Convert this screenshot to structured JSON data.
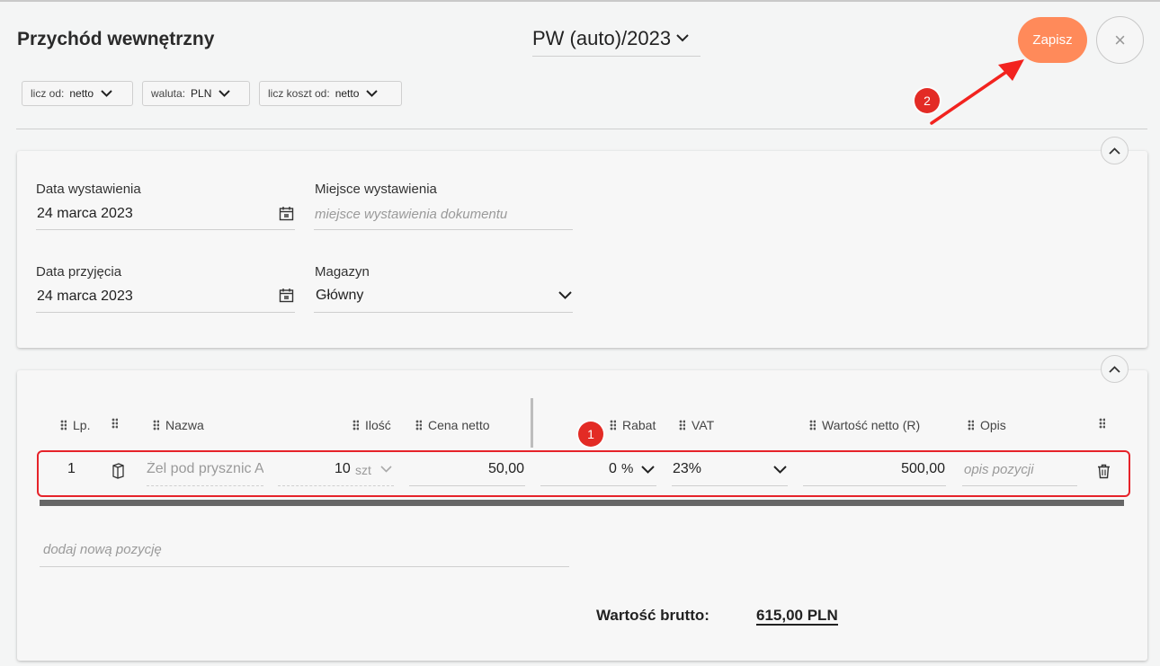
{
  "header": {
    "title": "Przychód wewnętrzny",
    "doc_number": "PW (auto)/2023",
    "save_label": "Zapisz",
    "close_label": "×"
  },
  "chips": [
    {
      "label": "licz od:",
      "value": "netto"
    },
    {
      "label": "waluta:",
      "value": "PLN"
    },
    {
      "label": "licz koszt od:",
      "value": "netto"
    }
  ],
  "form": {
    "issue_date_label": "Data wystawienia",
    "issue_date_value": "24 marca 2023",
    "issue_place_label": "Miejsce wystawienia",
    "issue_place_placeholder": "miejsce wystawienia dokumentu",
    "receipt_date_label": "Data przyjęcia",
    "receipt_date_value": "24 marca 2023",
    "warehouse_label": "Magazyn",
    "warehouse_value": "Główny"
  },
  "table": {
    "columns": [
      "Lp.",
      "Nazwa",
      "Ilość",
      "Cena netto",
      "Rabat",
      "VAT",
      "Wartość netto (R)",
      "Opis"
    ],
    "rows": [
      {
        "lp": "1",
        "name": "Żel pod prysznic A",
        "qty": "10",
        "unit": "szt",
        "price": "50,00",
        "discount": "0",
        "discount_unit": "%",
        "vat": "23%",
        "net_value": "500,00",
        "desc_placeholder": "opis pozycji"
      }
    ],
    "add_placeholder": "dodaj nową pozycję"
  },
  "totals": {
    "gross_label": "Wartość brutto:",
    "gross_value": "615,00 PLN"
  },
  "annotations": {
    "badge1": "1",
    "badge2": "2"
  },
  "colors": {
    "accent": "#ff8a5a",
    "annotation_red": "#e6232a"
  }
}
